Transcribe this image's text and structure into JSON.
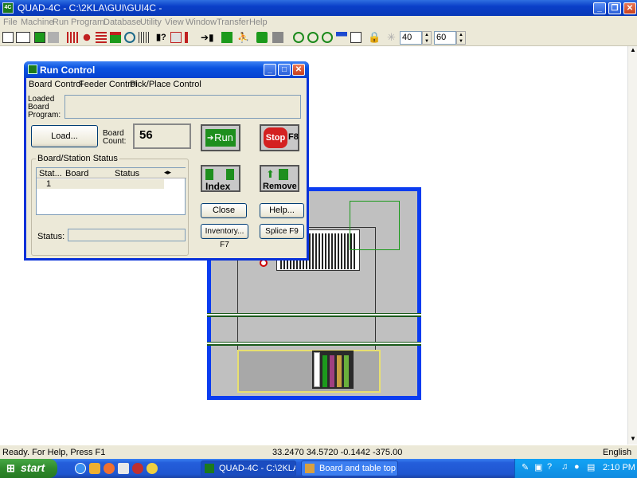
{
  "app": {
    "title": "QUAD-4C - C:\\2KLA\\GUI\\GUI4C -",
    "icon": "app-icon"
  },
  "menu": [
    "File",
    "Machine",
    "Run",
    "Program",
    "Database",
    "Utility",
    "View",
    "Window",
    "Transfer",
    "Help"
  ],
  "toolbar": {
    "spin1_value": "40",
    "spin2_value": "60"
  },
  "run_control": {
    "title": "Run Control",
    "menu": [
      "Board Control",
      "Feeder Control",
      "Pick/Place Control"
    ],
    "loaded_board_label": "Loaded Board Program:",
    "loaded_board_value": "",
    "load_button": "Load...",
    "board_count_label": "Board Count:",
    "board_count_value": "56",
    "run_button": "Run",
    "stop_button": "Stop",
    "stop_key": "F8",
    "index_button": "Index",
    "remove_button": "Remove",
    "station_group": "Board/Station Status",
    "station_columns": [
      "Stat...",
      "Board",
      "Status"
    ],
    "station_rows": [
      [
        "1",
        "",
        ""
      ]
    ],
    "status_label": "Status:",
    "status_value": "",
    "close_button": "Close",
    "help_button": "Help...",
    "inventory_button": "Inventory...  F7",
    "splice_button": "Splice  F9"
  },
  "statusbar": {
    "message": "Ready.  For Help, Press F1",
    "coords": "33.2470 34.5720 -0.1442 -375.00",
    "language": "English"
  },
  "taskbar": {
    "start": "start",
    "tasks": [
      "QUAD-4C - C:\\2KLA\\...",
      "Board and table top ..."
    ],
    "clock": "2:10 PM"
  },
  "colors": {
    "xp_blue": "#0a3fc8",
    "board_blue": "#0b3cf0",
    "run_green": "#1e8f1e",
    "stop_red": "#d42020"
  }
}
